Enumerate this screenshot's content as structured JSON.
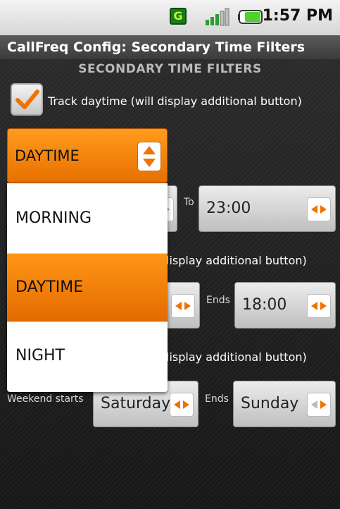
{
  "status_bar": {
    "time": "1:57 PM",
    "notification_letter": "G",
    "icons": [
      "g-notification-icon",
      "signal-icon",
      "battery-icon"
    ]
  },
  "title_bar": {
    "title": "CallFreq Config: Secondary Time Filters"
  },
  "section": {
    "header": "SECONDARY TIME FILTERS"
  },
  "daytime": {
    "checkbox_label": "Track daytime (will display additional button)",
    "checked": true,
    "to_label": "To",
    "to_value": "23:00"
  },
  "row2": {
    "checkbox_label_partial": "lisplay additional button)",
    "ends_label": "Ends",
    "ends_value": "18:00"
  },
  "row3": {
    "checkbox_label_partial": "lisplay additional button)",
    "weekend_label": "Weekend starts",
    "starts_value": "Saturday",
    "ends_label": "Ends",
    "ends_value": "Sunday"
  },
  "dropdown": {
    "selected": "DAYTIME",
    "options": [
      "MORNING",
      "DAYTIME",
      "NIGHT"
    ],
    "accent": "#ff8a00"
  }
}
